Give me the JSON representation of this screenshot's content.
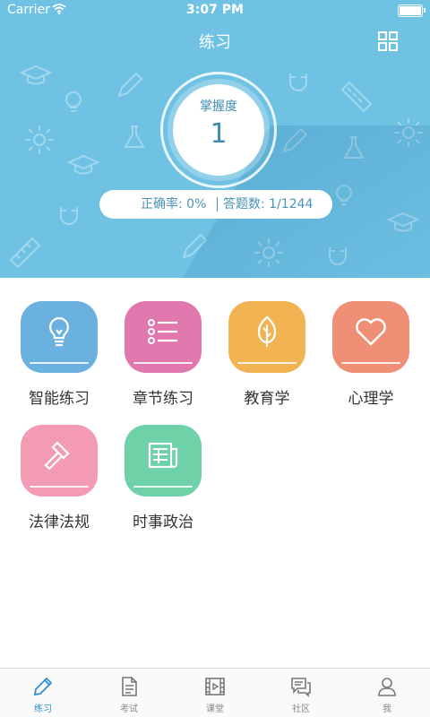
{
  "status_bar": {
    "carrier": "Carrier",
    "time": "3:07 PM"
  },
  "header": {
    "title": "练习"
  },
  "mastery": {
    "label": "掌握度",
    "value": "1"
  },
  "stats": {
    "accuracy": "正确率: 0%",
    "answered": "答题数: 1/1244"
  },
  "categories": [
    {
      "label": "智能练习",
      "icon": "lightbulb-icon",
      "color": "#6ab1e0"
    },
    {
      "label": "章节练习",
      "icon": "list-icon",
      "color": "#e077ad"
    },
    {
      "label": "教育学",
      "icon": "leaf-icon",
      "color": "#f2b452"
    },
    {
      "label": "心理学",
      "icon": "heart-icon",
      "color": "#ef8f75"
    },
    {
      "label": "法律法规",
      "icon": "gavel-icon",
      "color": "#f29bb3"
    },
    {
      "label": "时事政治",
      "icon": "newspaper-icon",
      "color": "#6fd1a8"
    }
  ],
  "tabs": [
    {
      "label": "练习",
      "icon": "pencil-icon",
      "active": true
    },
    {
      "label": "考试",
      "icon": "document-icon"
    },
    {
      "label": "课堂",
      "icon": "film-icon"
    },
    {
      "label": "社区",
      "icon": "chat-icon"
    },
    {
      "label": "我",
      "icon": "person-icon"
    }
  ],
  "colors": {
    "hero_bg": "#6fc2e4",
    "accent": "#3f8db5",
    "tab_active": "#2f8fd0"
  }
}
